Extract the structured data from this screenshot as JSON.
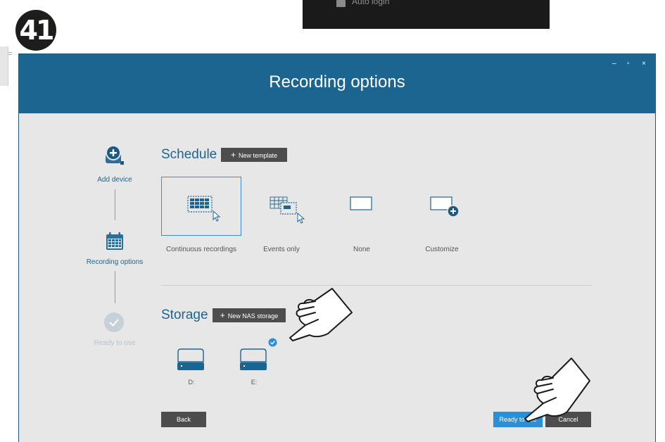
{
  "badge": {
    "number": "41"
  },
  "top_panel": {
    "auto_login_label": "Auto login"
  },
  "window": {
    "title": "Recording options",
    "controls": {
      "minimize": "–",
      "maximize": "▫",
      "close": "×"
    }
  },
  "sidebar": {
    "steps": [
      {
        "label": "Add device",
        "state": "done"
      },
      {
        "label": "Recording options",
        "state": "current"
      },
      {
        "label": "Ready to use",
        "state": "pending"
      }
    ]
  },
  "schedule": {
    "title": "Schedule",
    "new_template_label": "New template",
    "options": [
      {
        "label": "Continuous recordings",
        "selected": true
      },
      {
        "label": "Events only",
        "selected": false
      },
      {
        "label": "None",
        "selected": false
      },
      {
        "label": "Customize",
        "selected": false
      }
    ]
  },
  "storage": {
    "title": "Storage",
    "new_nas_label": "New NAS storage",
    "drives": [
      {
        "label": "D:",
        "selected": false
      },
      {
        "label": "E:",
        "selected": true
      }
    ]
  },
  "footer": {
    "back_label": "Back",
    "ready_label": "Ready to use",
    "cancel_label": "Cancel"
  },
  "colors": {
    "accent": "#1d6591",
    "primary_button": "#2a8fd8",
    "dark_button": "#4d4d4d",
    "background": "#e7e7e7"
  }
}
